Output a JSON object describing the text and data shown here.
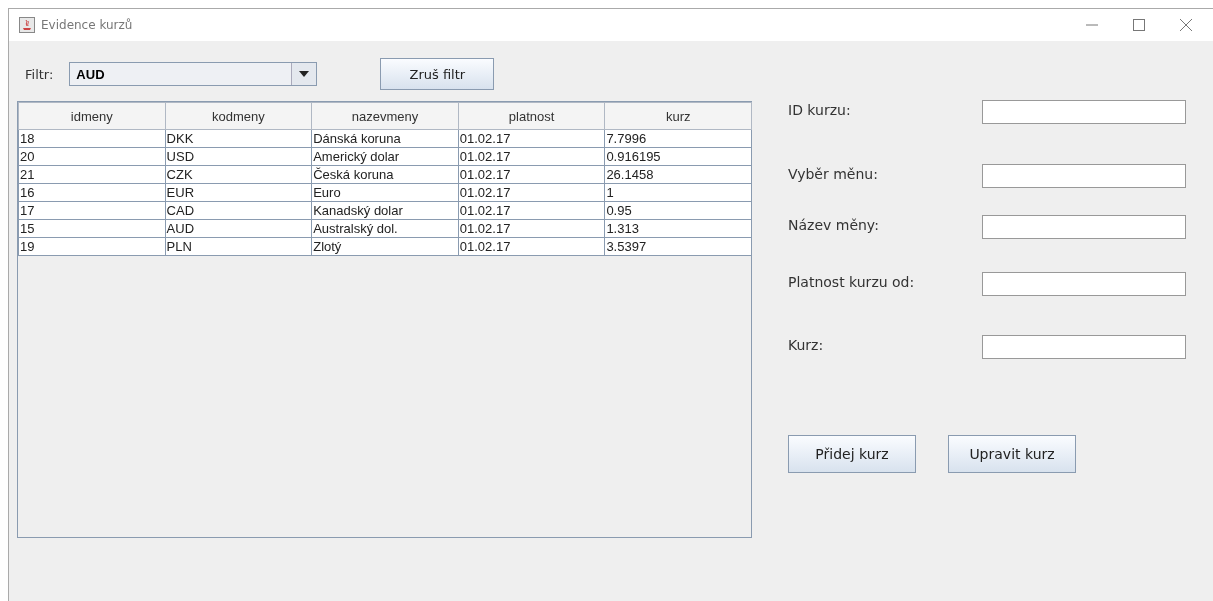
{
  "window": {
    "title": "Evidence kurzů"
  },
  "filter": {
    "label": "Filtr:",
    "value": "AUD"
  },
  "clear_filter_button": "Zruš filtr",
  "table": {
    "columns": [
      "idmeny",
      "kodmeny",
      "nazevmeny",
      "platnost",
      "kurz"
    ],
    "rows": [
      [
        "18",
        "DKK",
        "Dánská koruna",
        "01.02.17",
        "7.7996"
      ],
      [
        "20",
        "USD",
        "Americký dolar",
        "01.02.17",
        "0.916195"
      ],
      [
        "21",
        "CZK",
        "Česká koruna",
        "01.02.17",
        "26.1458"
      ],
      [
        "16",
        "EUR",
        "Euro",
        "01.02.17",
        "1"
      ],
      [
        "17",
        "CAD",
        "Kanadský dolar",
        "01.02.17",
        "0.95"
      ],
      [
        "15",
        "AUD",
        "Australský dol.",
        "01.02.17",
        "1.313"
      ],
      [
        "19",
        "PLN",
        "Zlotý",
        "01.02.17",
        "3.5397"
      ]
    ]
  },
  "form": [
    {
      "label": "ID kurzu:"
    },
    {
      "label": "Vyběr měnu:"
    },
    {
      "label": "Název měny:"
    },
    {
      "label": "Platnost kurzu od:"
    },
    {
      "label": "Kurz:"
    }
  ],
  "buttons": [
    "Přidej kurz",
    "Upravit kurz"
  ]
}
